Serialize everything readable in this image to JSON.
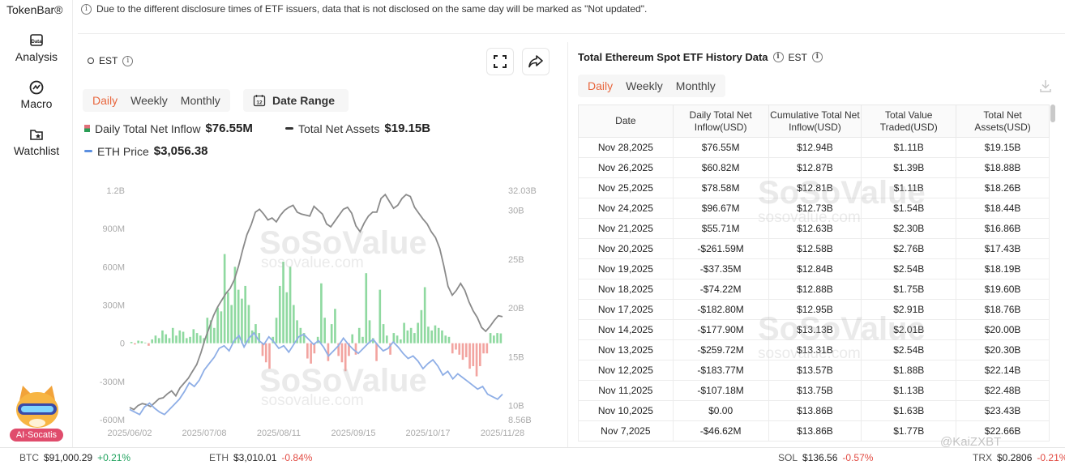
{
  "nav": {
    "brand": "TokenBar®",
    "items": [
      {
        "label": "Analysis",
        "icon": "data-analysis-icon"
      },
      {
        "label": "Macro",
        "icon": "macro-icon"
      },
      {
        "label": "Watchlist",
        "icon": "watchlist-icon"
      }
    ],
    "assistant_label": "AI·Socatis"
  },
  "notice": "Due to the different disclosure times of ETF issuers, data that is not disclosed on the same day will be marked as \"Not updated\".",
  "chart_panel": {
    "timezone": "EST",
    "tabs": [
      "Daily",
      "Weekly",
      "Monthly"
    ],
    "active_tab": "Daily",
    "date_range_label": "Date Range",
    "date_range_icon_text": "12",
    "legend": {
      "inflow_label": "Daily Total Net Inflow",
      "inflow_value": "$76.55M",
      "assets_label": "Total Net Assets",
      "assets_value": "$19.15B",
      "eth_label": "ETH Price",
      "eth_value": "$3,056.38"
    },
    "watermark_brand": "SoSoValue",
    "watermark_site": "sosovalue.com"
  },
  "chart_data": {
    "type": "bar",
    "series_labels": [
      "Daily Total Net Inflow",
      "Total Net Assets",
      "ETH Price"
    ],
    "left_axis_ticks": [
      "1.2B",
      "900M",
      "600M",
      "300M",
      "0",
      "-300M",
      "-600M"
    ],
    "left_axis_values": [
      1200,
      900,
      600,
      300,
      0,
      -300,
      -600
    ],
    "right_axis_ticks": [
      "32.03B",
      "30B",
      "25B",
      "20B",
      "15B",
      "10B",
      "8.56B"
    ],
    "right_axis_values": [
      32.03,
      30,
      25,
      20,
      15,
      10,
      8.56
    ],
    "x_ticks": [
      "2025/06/02",
      "2025/07/08",
      "2025/08/11",
      "2025/09/15",
      "2025/10/17",
      "2025/11/28"
    ],
    "ylim": [
      -600,
      1200
    ],
    "y2lim": [
      8.56,
      32.03
    ],
    "inflow": [
      10,
      -10,
      20,
      15,
      5,
      -20,
      30,
      60,
      40,
      100,
      70,
      40,
      120,
      60,
      100,
      90,
      40,
      50,
      110,
      80,
      60,
      40,
      200,
      180,
      120,
      280,
      250,
      700,
      400,
      300,
      600,
      420,
      350,
      450,
      300,
      100,
      150,
      80,
      -100,
      -150,
      -200,
      50,
      200,
      450,
      640,
      400,
      600,
      300,
      180,
      120,
      80,
      -120,
      -160,
      -80,
      50,
      470,
      200,
      -140,
      150,
      270,
      -100,
      -150,
      -220,
      -100,
      70,
      -90,
      120,
      50,
      550,
      180,
      40,
      -140,
      420,
      150,
      60,
      -90,
      80,
      60,
      30,
      160,
      100,
      120,
      80,
      160,
      260,
      440,
      130,
      100,
      140,
      120,
      100,
      60,
      50,
      -80,
      -50,
      -90,
      -130,
      -110,
      -200,
      -180,
      -260,
      -180,
      -80,
      -80,
      80,
      60,
      80,
      77
    ],
    "net_assets": [
      9.8,
      9.6,
      10.0,
      10.2,
      10.1,
      9.9,
      10.3,
      10.7,
      10.8,
      11.2,
      11.5,
      11.0,
      11.8,
      12.3,
      12.8,
      13.5,
      14.2,
      15.4,
      16.8,
      18.0,
      19.2,
      20.1,
      20.8,
      21.5,
      22.0,
      22.9,
      24.3,
      26.0,
      27.5,
      28.5,
      29.8,
      30.1,
      29.6,
      29.0,
      29.2,
      28.8,
      29.5,
      30.0,
      30.3,
      30.5,
      29.8,
      29.6,
      29.5,
      29.4,
      30.4,
      30.0,
      29.6,
      28.6,
      28.3,
      28.9,
      29.5,
      30.1,
      30.3,
      29.7,
      28.4,
      27.8,
      28.7,
      29.4,
      29.8,
      29.8,
      31.2,
      31.6,
      30.9,
      30.2,
      30.5,
      31.2,
      31.6,
      31.4,
      30.3,
      29.7,
      29.1,
      28.6,
      27.8,
      27.2,
      26.1,
      24.3,
      22.2,
      21.3,
      21.8,
      22.5,
      21.8,
      20.6,
      19.7,
      19.0,
      18.0,
      17.6,
      18.1,
      18.7,
      19.2,
      19.1
    ]
  },
  "table_panel": {
    "title": "Total Ethereum Spot ETF History Data",
    "timezone": "EST",
    "tabs": [
      "Daily",
      "Weekly",
      "Monthly"
    ],
    "active_tab": "Daily",
    "columns": [
      "Date",
      "Daily Total Net Inflow(USD)",
      "Cumulative Total Net Inflow(USD)",
      "Total Value Traded(USD)",
      "Total Net Assets(USD)"
    ],
    "rows": [
      [
        "Nov 28,2025",
        "$76.55M",
        "$12.94B",
        "$1.11B",
        "$19.15B"
      ],
      [
        "Nov 26,2025",
        "$60.82M",
        "$12.87B",
        "$1.39B",
        "$18.88B"
      ],
      [
        "Nov 25,2025",
        "$78.58M",
        "$12.81B",
        "$1.11B",
        "$18.26B"
      ],
      [
        "Nov 24,2025",
        "$96.67M",
        "$12.73B",
        "$1.54B",
        "$18.44B"
      ],
      [
        "Nov 21,2025",
        "$55.71M",
        "$12.63B",
        "$2.30B",
        "$16.86B"
      ],
      [
        "Nov 20,2025",
        "-$261.59M",
        "$12.58B",
        "$2.76B",
        "$17.43B"
      ],
      [
        "Nov 19,2025",
        "-$37.35M",
        "$12.84B",
        "$2.54B",
        "$18.19B"
      ],
      [
        "Nov 18,2025",
        "-$74.22M",
        "$12.88B",
        "$1.75B",
        "$19.60B"
      ],
      [
        "Nov 17,2025",
        "-$182.80M",
        "$12.95B",
        "$2.91B",
        "$18.76B"
      ],
      [
        "Nov 14,2025",
        "-$177.90M",
        "$13.13B",
        "$2.01B",
        "$20.00B"
      ],
      [
        "Nov 13,2025",
        "-$259.72M",
        "$13.31B",
        "$2.54B",
        "$20.30B"
      ],
      [
        "Nov 12,2025",
        "-$183.77M",
        "$13.57B",
        "$1.88B",
        "$22.14B"
      ],
      [
        "Nov 11,2025",
        "-$107.18M",
        "$13.75B",
        "$1.13B",
        "$22.48B"
      ],
      [
        "Nov 10,2025",
        "$0.00",
        "$13.86B",
        "$1.63B",
        "$23.43B"
      ],
      [
        "Nov 7,2025",
        "-$46.62M",
        "$13.86B",
        "$1.77B",
        "$22.66B"
      ]
    ]
  },
  "ticker": [
    {
      "symbol": "BTC",
      "price": "$91,000.29",
      "change": "+0.21%",
      "direction": "up"
    },
    {
      "symbol": "ETH",
      "price": "$3,010.01",
      "change": "-0.84%",
      "direction": "down"
    },
    {
      "symbol": "SOL",
      "price": "$136.56",
      "change": "-0.57%",
      "direction": "down"
    },
    {
      "symbol": "TRX",
      "price": "$0.2806",
      "change": "-0.21%",
      "direction": "down"
    }
  ],
  "footer_watermark": "@KaiZXBT",
  "colors": {
    "accent": "#e8663d",
    "inflow_positive": "#8fd9a0",
    "inflow_negative": "#f2a4a0",
    "net_assets_line": "#8a8a8a",
    "eth_price_line": "#8eaee6",
    "positive_text": "#23a460",
    "negative_text": "#e24b43"
  }
}
